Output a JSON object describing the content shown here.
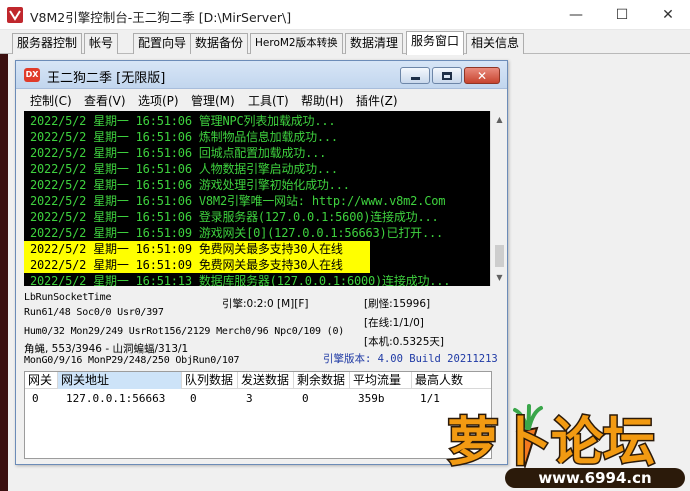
{
  "window": {
    "title": "V8M2引擎控制台-王二狗二季 [D:\\MirServer\\]",
    "minimize_glyph": "—",
    "maximize_glyph": "☐",
    "close_glyph": "✕"
  },
  "outer_tabs": [
    {
      "label": "服务器控制"
    },
    {
      "label": "帐号"
    },
    {
      "label": "配置向导"
    },
    {
      "label": "数据备份"
    },
    {
      "label": "HeroM2版本转换"
    },
    {
      "label": "数据清理"
    },
    {
      "label": "服务窗口"
    },
    {
      "label": "相关信息"
    }
  ],
  "inner": {
    "logo_text": "DX",
    "title": "王二狗二季 [无限版]",
    "menu": [
      "控制(C)",
      "查看(V)",
      "选项(P)",
      "管理(M)",
      "工具(T)",
      "帮助(H)",
      "插件(Z)"
    ]
  },
  "log": [
    {
      "text": "2022/5/2 星期一 16:51:06 管理NPC列表加载成功...",
      "highlight": false
    },
    {
      "text": "2022/5/2 星期一 16:51:06 炼制物品信息加载成功...",
      "highlight": false
    },
    {
      "text": "2022/5/2 星期一 16:51:06 回城点配置加载成功...",
      "highlight": false
    },
    {
      "text": "2022/5/2 星期一 16:51:06 人物数据引擎启动成功...",
      "highlight": false
    },
    {
      "text": "2022/5/2 星期一 16:51:06 游戏处理引擎初始化成功...",
      "highlight": false
    },
    {
      "text": "2022/5/2 星期一 16:51:06 V8M2引擎唯一网站: http://www.v8m2.Com",
      "highlight": false
    },
    {
      "text": "2022/5/2 星期一 16:51:06 登录服务器(127.0.0.1:5600)连接成功...",
      "highlight": false
    },
    {
      "text": "2022/5/2 星期一 16:51:09 游戏网关[0](127.0.0.1:56663)已打开...",
      "highlight": false
    },
    {
      "text": "2022/5/2 星期一 16:51:09 免费网关最多支持30人在线",
      "highlight": true
    },
    {
      "text": "2022/5/2 星期一 16:51:09 免费网关最多支持30人在线",
      "highlight": true
    },
    {
      "text": "2022/5/2 星期一 16:51:13 数据库服务器(127.0.0.1:6000)连接成功...",
      "highlight": false
    }
  ],
  "status": {
    "socket_time": "LbRunSocketTime",
    "run_line": "Run61/48 Soc0/0 Usr0/397",
    "engine": "引擎:0:2:0 [M][F]",
    "refresh": "[刷怪:15996]",
    "hum_line": "Hum0/32 Mon29/249 UsrRot156/2129 Merch0/96 Npc0/109 (0)",
    "online": "[在线:1/1/0]",
    "map_line": "角蝇, 553/3946 - 山洞蝙蝠/313/1",
    "native": "[本机:0.5325天]",
    "mongen_line": "MonG0/9/16 MonP29/248/250 ObjRun0/107",
    "version": "引擎版本: 4.00 Build 20211213"
  },
  "table": {
    "headers": [
      "网关",
      "网关地址",
      "队列数据",
      "发送数据",
      "剩余数据",
      "平均流量",
      "最高人数"
    ],
    "rows": [
      [
        "0",
        "127.0.0.1:56663",
        "0",
        "3",
        "0",
        "359b",
        "1/1"
      ]
    ]
  },
  "watermark": {
    "text": "萝卜论坛",
    "url": "www.6994.cn"
  },
  "colors": {
    "log_text": "#3ed13e",
    "log_highlight": "#ffff00",
    "version_text": "#1f3aa5",
    "watermark_orange": "#f29a12"
  }
}
